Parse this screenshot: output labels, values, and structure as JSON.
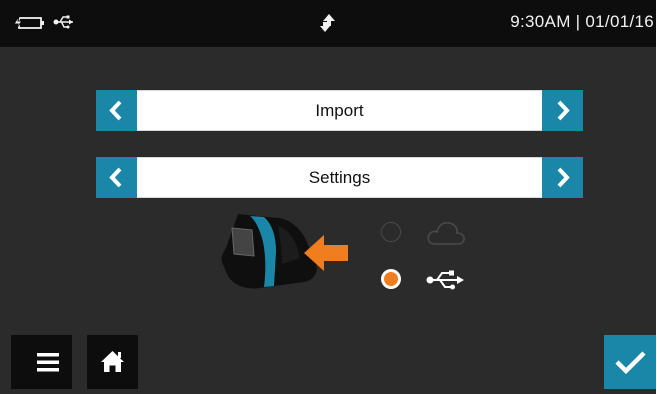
{
  "status_bar": {
    "time_date": "9:30AM | 01/01/16",
    "icons": [
      "battery-charging-icon",
      "usb-icon",
      "sync-arrows-icon"
    ]
  },
  "selectors": [
    {
      "label": "Import",
      "prev_icon": "chevron-left-icon",
      "next_icon": "chevron-right-icon"
    },
    {
      "label": "Settings",
      "prev_icon": "chevron-left-icon",
      "next_icon": "chevron-right-icon"
    }
  ],
  "connection_options": [
    {
      "option": "cloud",
      "icon": "cloud-icon",
      "selected": false
    },
    {
      "option": "usb",
      "icon": "usb-icon",
      "selected": true
    }
  ],
  "device_illustration": {
    "icon": "handheld-device-icon",
    "arrow_icon": "arrow-left-icon"
  },
  "bottom_bar": {
    "menu_icon": "hamburger-menu-icon",
    "home_icon": "home-icon",
    "confirm_icon": "checkmark-icon"
  },
  "colors": {
    "background": "#2b2b2b",
    "status_bar": "#0d0d0d",
    "accent": "#1a86a8",
    "selected_radio": "#f07d1e",
    "arrow": "#f07d1e"
  }
}
